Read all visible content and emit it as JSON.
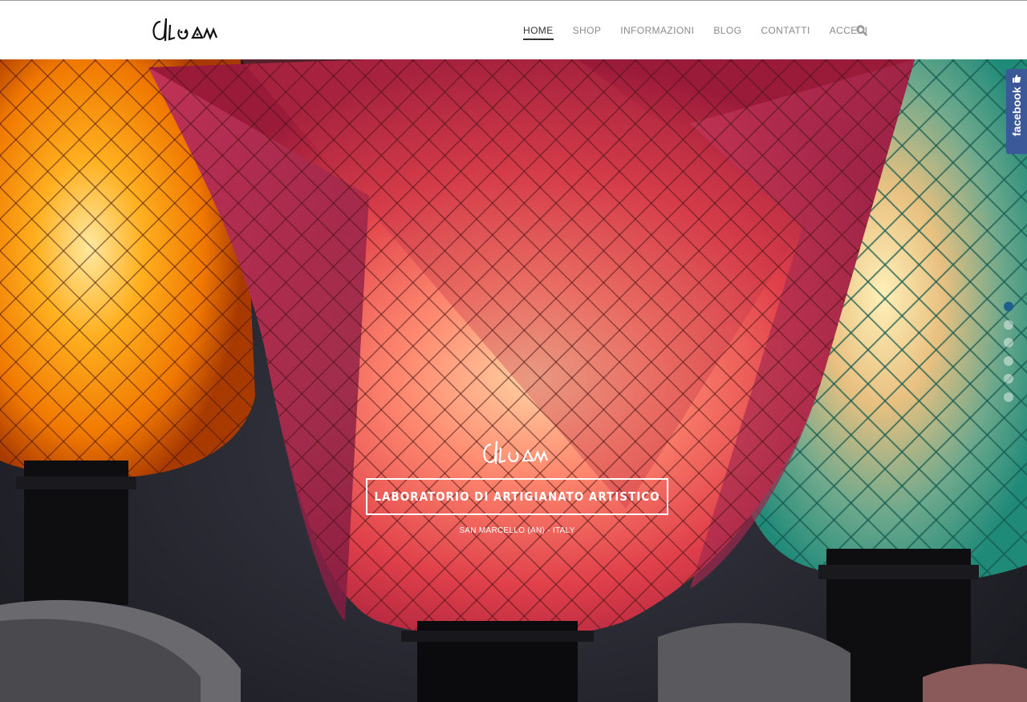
{
  "brand": {
    "logo_text": "dLuan"
  },
  "nav": {
    "items": [
      {
        "label": "HOME",
        "active": true
      },
      {
        "label": "SHOP",
        "active": false
      },
      {
        "label": "INFORMAZIONI",
        "active": false
      },
      {
        "label": "BLOG",
        "active": false
      },
      {
        "label": "CONTATTI",
        "active": false
      },
      {
        "label": "ACCEDI",
        "active": false
      }
    ],
    "search_icon": "search-icon"
  },
  "hero": {
    "logo_text": "dLuan",
    "title": "LABORATORIO DI ARTIGIANATO ARTISTICO",
    "subtitle": "SAN MARCELLO (AN) - ITALY",
    "slides": {
      "count": 6,
      "active_index": 0
    }
  },
  "facebook_tab": {
    "label": "facebook",
    "icon": "thumbs-up-icon"
  },
  "colors": {
    "header_bg": "#ffffff",
    "facebook_blue": "#3b5998",
    "active_dot": "#1f5f8b"
  }
}
